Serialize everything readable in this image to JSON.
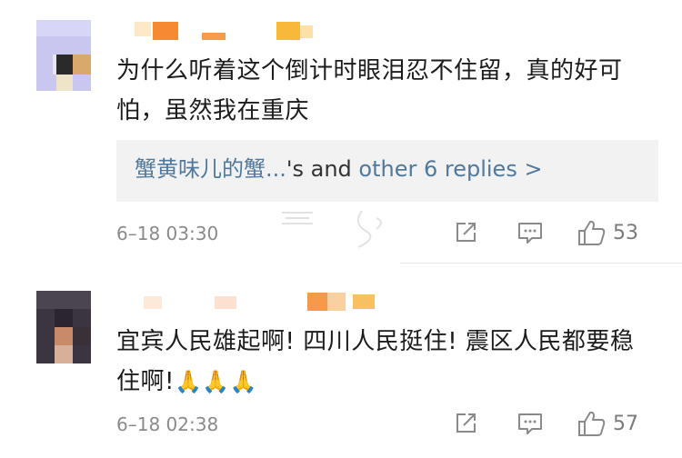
{
  "comments": [
    {
      "text": "为什么听着这个倒计时眼泪忍不住留，真的好可怕，虽然我在重庆",
      "replies": {
        "author": "蟹黄味儿的蟹...",
        "connector": "'s and ",
        "more": "other 6 replies >"
      },
      "time": "6–18 03:30",
      "likes": "53"
    },
    {
      "text": "宜宾人民雄起啊! 四川人民挺住! 震区人民都要稳住啊!",
      "emoji": "🙏🙏🙏",
      "time": "6–18 02:38",
      "likes": "57"
    }
  ],
  "icons": {
    "share": "share-icon",
    "comment": "comment-icon",
    "like": "thumbs-up-icon"
  },
  "colors": {
    "link": "#50799e",
    "meta": "#8a8a8a",
    "reply_bg": "#f2f2f2"
  }
}
